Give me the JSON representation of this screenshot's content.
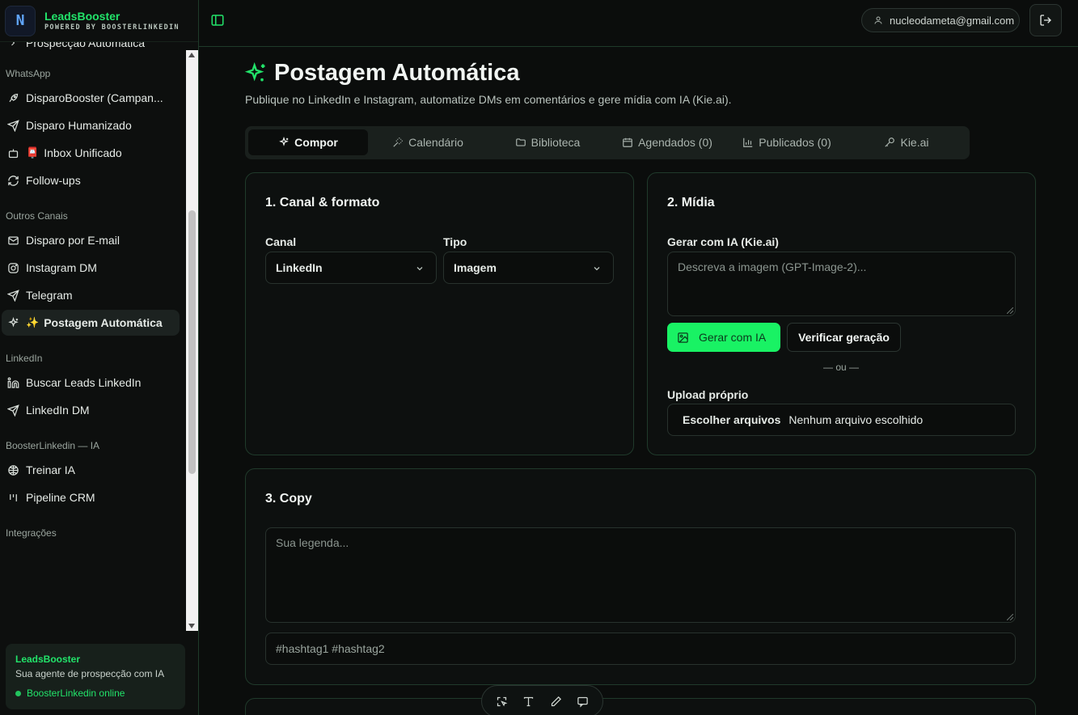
{
  "brand": {
    "name": "LeadsBooster",
    "subtitle": "POWERED BY BOOSTERLINKEDIN",
    "logo_text": "N"
  },
  "sidebar": {
    "partial_top_item": "Prospecção Automática",
    "sections": [
      {
        "title": "WhatsApp",
        "items": [
          {
            "label": "DisparoBooster (Campan...",
            "icon": "rocket-icon"
          },
          {
            "label": "Disparo Humanizado",
            "icon": "send-icon"
          },
          {
            "label": "Inbox Unificado",
            "icon": "bot-icon",
            "emoji": "📮"
          },
          {
            "label": "Follow-ups",
            "icon": "refresh-icon"
          }
        ]
      },
      {
        "title": "Outros Canais",
        "items": [
          {
            "label": "Disparo por E-mail",
            "icon": "mail-icon"
          },
          {
            "label": "Instagram DM",
            "icon": "instagram-icon"
          },
          {
            "label": "Telegram",
            "icon": "send-icon"
          },
          {
            "label": "Postagem Automática",
            "icon": "sparkles-icon",
            "emoji": "✨",
            "active": true
          }
        ]
      },
      {
        "title": "LinkedIn",
        "items": [
          {
            "label": "Buscar Leads LinkedIn",
            "icon": "linkedin-icon"
          },
          {
            "label": "LinkedIn DM",
            "icon": "send-icon"
          }
        ]
      },
      {
        "title": "BoosterLinkedin — IA",
        "items": [
          {
            "label": "Treinar IA",
            "icon": "brain-icon"
          },
          {
            "label": "Pipeline CRM",
            "icon": "kanban-icon"
          }
        ]
      },
      {
        "title": "Integrações",
        "items": []
      }
    ],
    "agent_card": {
      "title": "LeadsBooster",
      "description": "Sua agente de prospecção com IA",
      "status": "BoosterLinkedin online"
    }
  },
  "topbar": {
    "user_email": "nucleodameta@gmail.com"
  },
  "page": {
    "title": "Postagem Automática",
    "subtitle": "Publique no LinkedIn e Instagram, automatize DMs em comentários e gere mídia com IA (Kie.ai).",
    "tabs": [
      {
        "label": "Compor",
        "icon": "sparkles-icon",
        "active": true
      },
      {
        "label": "Calendário",
        "icon": "wand-icon"
      },
      {
        "label": "Biblioteca",
        "icon": "folder-icon"
      },
      {
        "label": "Agendados (0)",
        "icon": "calendar-icon"
      },
      {
        "label": "Publicados (0)",
        "icon": "bar-chart-icon"
      },
      {
        "label": "Kie.ai",
        "icon": "key-icon"
      }
    ]
  },
  "card_channel": {
    "title": "1. Canal & formato",
    "channel_label": "Canal",
    "channel_value": "LinkedIn",
    "type_label": "Tipo",
    "type_value": "Imagem"
  },
  "card_media": {
    "title": "2. Mídia",
    "ai_label": "Gerar com IA (Kie.ai)",
    "ai_placeholder": "Descreva a imagem (GPT-Image-2)...",
    "generate_button": "Gerar com IA",
    "verify_button": "Verificar geração",
    "or_text": "— ou —",
    "upload_label": "Upload próprio",
    "file_button": "Escolher arquivos",
    "file_status": "Nenhum arquivo escolhido"
  },
  "card_copy": {
    "title": "3. Copy",
    "caption_placeholder": "Sua legenda...",
    "hashtags_placeholder": "#hashtag1 #hashtag2"
  },
  "colors": {
    "accent": "#22e36a",
    "button_green": "#19f264",
    "border": "#203a2b",
    "background": "#0b0d0c"
  }
}
